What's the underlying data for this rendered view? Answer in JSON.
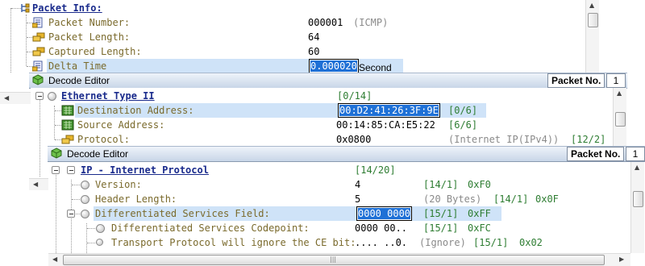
{
  "panel1": {
    "header": "Packet Info:",
    "rows": [
      {
        "label": "Packet Number:",
        "value": "000001",
        "note": "(ICMP)"
      },
      {
        "label": "Packet Length:",
        "value": "64"
      },
      {
        "label": "Captured Length:",
        "value": "60"
      },
      {
        "label": "Delta Time",
        "value": "0.000020",
        "unit": "Second"
      }
    ]
  },
  "panel2": {
    "title": "Decode Editor",
    "packet_no_label": "Packet No.",
    "packet_no_value": "1",
    "header": "Ethernet Type II",
    "header_range": "[0/14]",
    "rows": [
      {
        "label": "Destination Address:",
        "value": "00:D2:41:26:3F:9E",
        "range": "[0/6]"
      },
      {
        "label": "Source Address:",
        "value": "00:14:85:CA:E5:22",
        "range": "[6/6]"
      },
      {
        "label": "Protocol:",
        "value": "0x0800",
        "note": "(Internet IP(IPv4))",
        "range": "[12/2]"
      }
    ]
  },
  "panel3": {
    "title": "Decode Editor",
    "packet_no_label": "Packet No.",
    "packet_no_value": "1",
    "header": "IP - Internet Protocol",
    "header_range": "[14/20]",
    "rows": [
      {
        "label": "Version:",
        "value": "4",
        "range": "[14/1]",
        "hex": "0xF0"
      },
      {
        "label": "Header Length:",
        "value": "5",
        "note": "(20 Bytes)",
        "range": "[14/1]",
        "hex": "0x0F"
      },
      {
        "label": "Differentiated Services Field:",
        "value": "0000 0000",
        "range": "[15/1]",
        "hex": "0xFF"
      },
      {
        "label": "Differentiated Services Codepoint:",
        "value": "0000 00..",
        "range": "[15/1]",
        "hex": "0xFC"
      },
      {
        "label": "Transport Protocol will ignore the CE bit:",
        "value": ".... ..0.",
        "note": "(Ignore)",
        "range": "[15/1]",
        "hex": "0x02"
      }
    ]
  },
  "colors": {
    "label": "#7a6a2c",
    "header": "#1a2b8c",
    "range": "#2e7d32",
    "highlight": "#cfe3f8",
    "selection": "#1e70d6"
  }
}
